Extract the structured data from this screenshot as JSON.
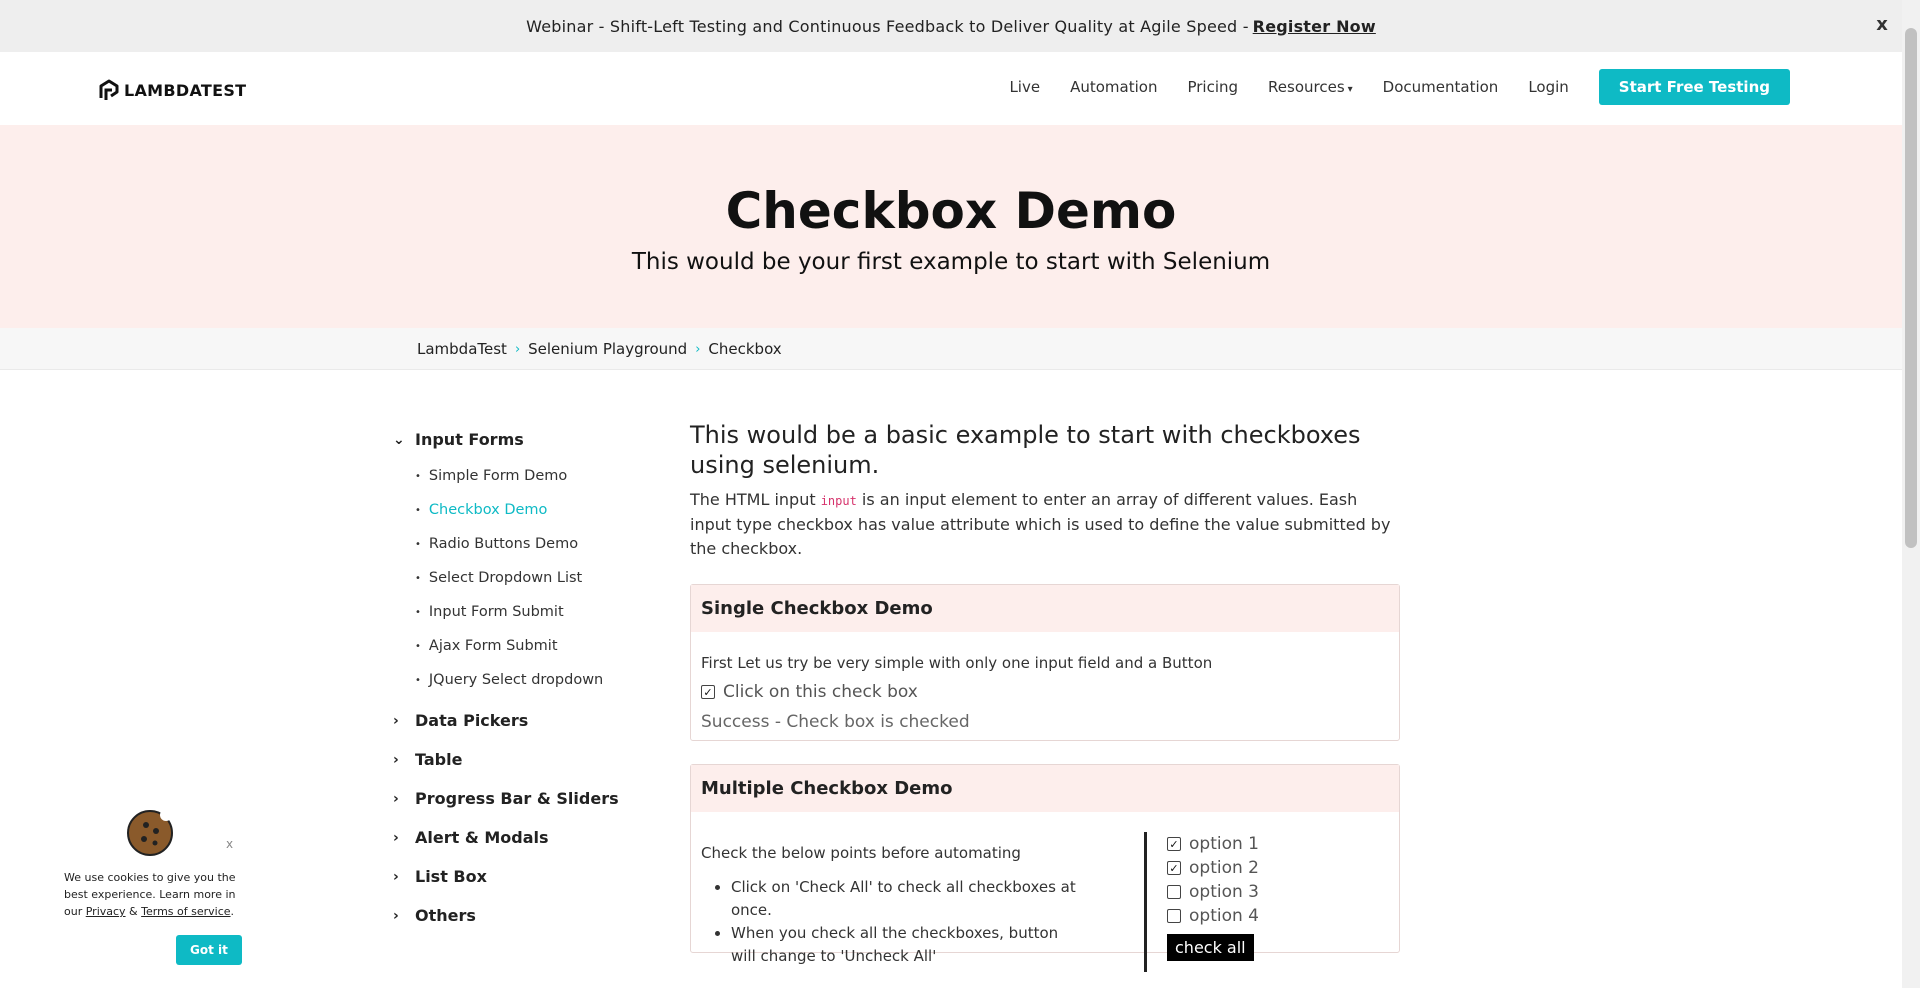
{
  "announcement": {
    "text": "Webinar - Shift-Left Testing and Continuous Feedback to Deliver Quality at Agile Speed -",
    "link": "Register Now",
    "close": "x"
  },
  "header": {
    "logo_text": "LAMBDATEST",
    "nav": [
      "Live",
      "Automation",
      "Pricing",
      "Resources",
      "Documentation",
      "Login"
    ],
    "cta": "Start Free Testing"
  },
  "hero": {
    "title": "Checkbox Demo",
    "subtitle": "This would be your first example to start with Selenium"
  },
  "breadcrumb": [
    "LambdaTest",
    "Selenium Playground",
    "Checkbox"
  ],
  "sidebar": {
    "expanded": {
      "label": "Input Forms",
      "items": [
        "Simple Form Demo",
        "Checkbox Demo",
        "Radio Buttons Demo",
        "Select Dropdown List",
        "Input Form Submit",
        "Ajax Form Submit",
        "JQuery Select dropdown"
      ],
      "active_index": 1
    },
    "collapsed": [
      "Data Pickers",
      "Table",
      "Progress Bar & Sliders",
      "Alert & Modals",
      "List Box",
      "Others"
    ]
  },
  "main": {
    "heading": "This would be a basic example to start with checkboxes using selenium.",
    "intro_before": "The HTML input ",
    "intro_code": "input",
    "intro_after": " is an input element to enter an array of different values. Eash input type checkbox has value attribute which is used to define the value submitted by the checkbox.",
    "single": {
      "title": "Single Checkbox Demo",
      "desc": "First Let us try be very simple with only one input field and a Button",
      "checkbox_label": "Click on this check box",
      "checked": true,
      "success": "Success - Check box is checked"
    },
    "multiple": {
      "title": "Multiple Checkbox Demo",
      "desc": "Check the below points before automating",
      "points": [
        "Click on 'Check All' to check all checkboxes at once.",
        "When you check all the checkboxes, button will change to 'Uncheck All'"
      ],
      "options": [
        {
          "label": "option 1",
          "checked": true
        },
        {
          "label": "option 2",
          "checked": true
        },
        {
          "label": "option 3",
          "checked": false
        },
        {
          "label": "option 4",
          "checked": false
        }
      ],
      "button": "check all"
    }
  },
  "cookie": {
    "text_1": "We use cookies to give you the best experience. Learn more in our ",
    "privacy": "Privacy",
    "amp": " & ",
    "terms": "Terms of service",
    "end": ".",
    "button": "Got it",
    "close": "x"
  },
  "colors": {
    "accent": "#0ebac5",
    "hero_bg": "#fdeeec"
  }
}
